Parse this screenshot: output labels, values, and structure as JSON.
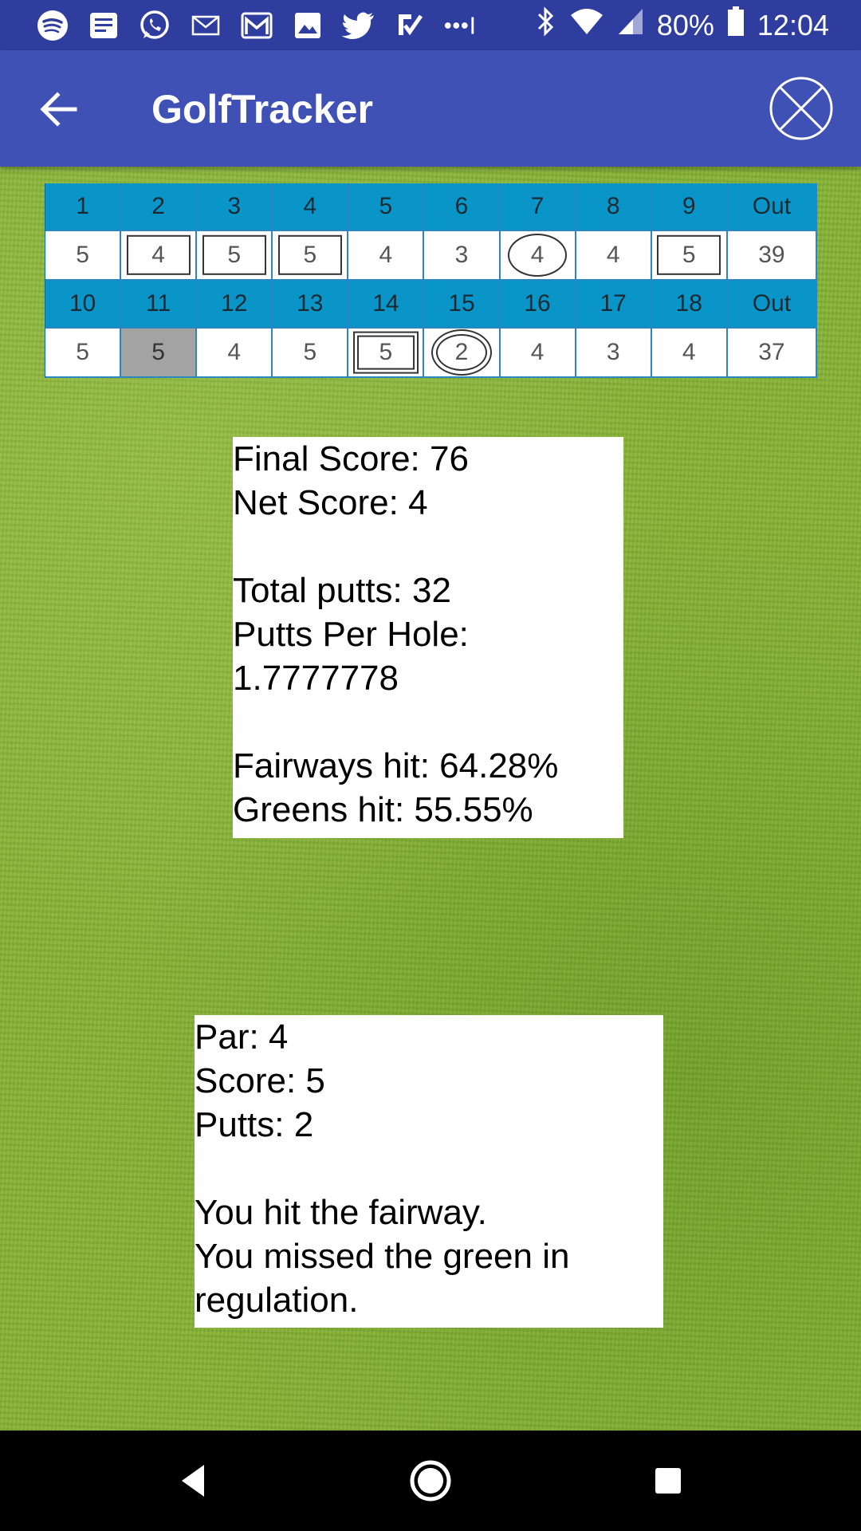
{
  "status_bar": {
    "battery": "80%",
    "time": "12:04",
    "left_icons": [
      "spotify-icon",
      "news-icon",
      "whatsapp-icon",
      "mail-icon",
      "gmail-icon",
      "photo-icon",
      "twitter-icon",
      "checkmark-app-icon",
      "more-icon"
    ]
  },
  "app_bar": {
    "title": "GolfTracker"
  },
  "scorecard": {
    "front": {
      "holes": [
        "1",
        "2",
        "3",
        "4",
        "5",
        "6",
        "7",
        "8",
        "9",
        "Out"
      ],
      "scores": [
        "5",
        "4",
        "5",
        "5",
        "4",
        "3",
        "4",
        "4",
        "5",
        "39"
      ],
      "marks": [
        "none",
        "box",
        "box",
        "box",
        "none",
        "none",
        "circle",
        "none",
        "box",
        "none"
      ]
    },
    "back": {
      "holes": [
        "10",
        "11",
        "12",
        "13",
        "14",
        "15",
        "16",
        "17",
        "18",
        "Out"
      ],
      "scores": [
        "5",
        "5",
        "4",
        "5",
        "5",
        "2",
        "4",
        "3",
        "4",
        "37"
      ],
      "marks": [
        "none",
        "none",
        "none",
        "none",
        "double-box",
        "double-circle",
        "none",
        "none",
        "none",
        "none"
      ],
      "selected_index": 1
    }
  },
  "summary": {
    "final_score": "Final Score: 76",
    "net_score": "Net Score: 4",
    "total_putts": "Total putts: 32",
    "putts_per_hole_label": "Putts Per Hole:",
    "putts_per_hole_value": "1.7777778",
    "fairways_hit": "Fairways hit: 64.28%",
    "greens_hit": "Greens hit: 55.55%"
  },
  "hole_detail": {
    "par": "Par: 4",
    "score": "Score: 5",
    "putts": "Putts: 2",
    "fairway": "You hit the fairway.",
    "green_line1": "You missed the green in",
    "green_line2": "regulation."
  }
}
